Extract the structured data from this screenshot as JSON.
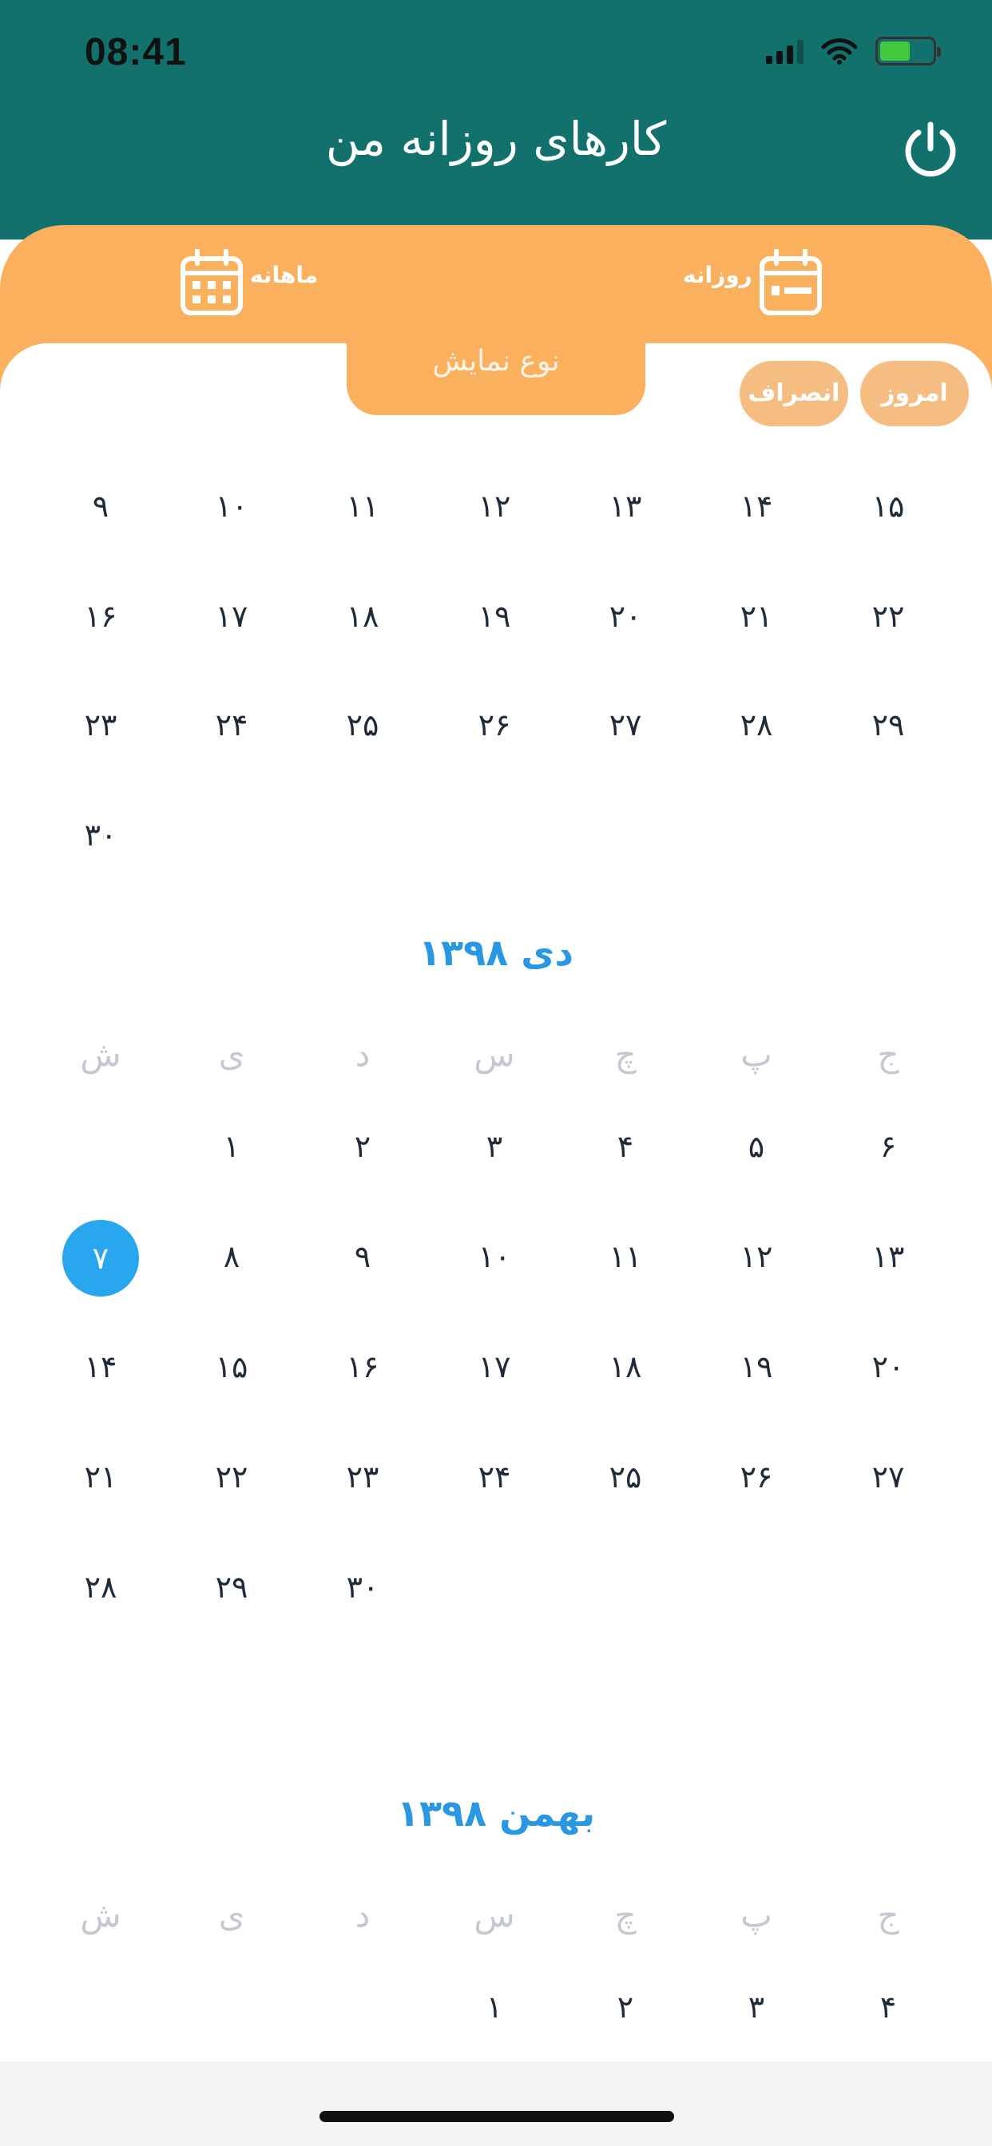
{
  "status_bar": {
    "time": "08:41"
  },
  "header": {
    "title": "کارهای روزانه من"
  },
  "modes": {
    "monthly": "ماهانه",
    "daily": "روزانه"
  },
  "view_type_label": "نوع نمایش",
  "buttons": {
    "today": "امروز",
    "cancel": "انصراف"
  },
  "colors": {
    "header": "#12706d",
    "accent": "#fbb05e",
    "selected": "#28a7ef",
    "month_title": "#2a97e3"
  },
  "partial_month": {
    "rows": [
      [
        "۱۵",
        "۱۴",
        "۱۳",
        "۱۲",
        "۱۱",
        "۱۰",
        "۹"
      ],
      [
        "۲۲",
        "۲۱",
        "۲۰",
        "۱۹",
        "۱۸",
        "۱۷",
        "۱۶"
      ],
      [
        "۲۹",
        "۲۸",
        "۲۷",
        "۲۶",
        "۲۵",
        "۲۴",
        "۲۳"
      ],
      [
        "",
        "",
        "",
        "",
        "",
        "",
        "۳۰"
      ]
    ]
  },
  "months": [
    {
      "title": "دی ۱۳۹۸",
      "weekdays": [
        "ج",
        "پ",
        "چ",
        "س",
        "د",
        "ی",
        "ش"
      ],
      "selected_day": "۷",
      "rows": [
        [
          "۶",
          "۵",
          "۴",
          "۳",
          "۲",
          "۱",
          ""
        ],
        [
          "۱۳",
          "۱۲",
          "۱۱",
          "۱۰",
          "۹",
          "۸",
          "۷"
        ],
        [
          "۲۰",
          "۱۹",
          "۱۸",
          "۱۷",
          "۱۶",
          "۱۵",
          "۱۴"
        ],
        [
          "۲۷",
          "۲۶",
          "۲۵",
          "۲۴",
          "۲۳",
          "۲۲",
          "۲۱"
        ],
        [
          "",
          "",
          "",
          "",
          "۳۰",
          "۲۹",
          "۲۸"
        ]
      ]
    },
    {
      "title": "بهمن ۱۳۹۸",
      "weekdays": [
        "ج",
        "پ",
        "چ",
        "س",
        "د",
        "ی",
        "ش"
      ],
      "rows": [
        [
          "۴",
          "۳",
          "۲",
          "۱",
          "",
          "",
          ""
        ]
      ]
    }
  ]
}
